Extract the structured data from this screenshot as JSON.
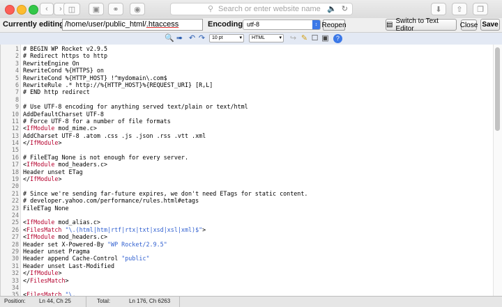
{
  "browser": {
    "address_placeholder": "Search or enter website name"
  },
  "editbar": {
    "currently_editing_label": "Currently editing:",
    "path_prefix": "/home/user/public_html/",
    "path_file": ".htaccess",
    "encoding_label": "Encoding:",
    "encoding_value": "utf-8",
    "reopen_label": "Reopen",
    "switch_label": "Switch to Text Editor",
    "close_label": "Close",
    "save_label": "Save"
  },
  "toolbar": {
    "font_size": "10 pt",
    "mode": "HTML"
  },
  "editor": {
    "lines": [
      {
        "n": "1",
        "t": "# BEGIN WP Rocket v2.9.5"
      },
      {
        "n": "2",
        "t": "# Redirect https to http"
      },
      {
        "n": "3",
        "t": "RewriteEngine On"
      },
      {
        "n": "4",
        "t": "RewriteCond %{HTTPS} on"
      },
      {
        "n": "5",
        "t": "RewriteCond %{HTTP_HOST} !^mydomain\\.com$"
      },
      {
        "n": "6",
        "t": "RewriteRule .* http://%{HTTP_HOST}%{REQUEST_URI} [R,L]"
      },
      {
        "n": "7",
        "t": "# END http redirect"
      },
      {
        "n": "8",
        "t": ""
      },
      {
        "n": "9",
        "t": "# Use UTF-8 encoding for anything served text/plain or text/html"
      },
      {
        "n": "10",
        "t": "AddDefaultCharset UTF-8"
      },
      {
        "n": "11",
        "t": "# Force UTF-8 for a number of file formats"
      },
      {
        "n": "12",
        "t": "<IfModule mod_mime.c>"
      },
      {
        "n": "13",
        "t": "AddCharset UTF-8 .atom .css .js .json .rss .vtt .xml"
      },
      {
        "n": "14",
        "t": "</IfModule>"
      },
      {
        "n": "15",
        "t": ""
      },
      {
        "n": "16",
        "t": "# FileETag None is not enough for every server."
      },
      {
        "n": "17",
        "t": "<IfModule mod_headers.c>"
      },
      {
        "n": "18",
        "t": "Header unset ETag"
      },
      {
        "n": "19",
        "t": "</IfModule>"
      },
      {
        "n": "20",
        "t": ""
      },
      {
        "n": "21",
        "t": "# Since we're sending far-future expires, we don't need ETags for static content."
      },
      {
        "n": "22",
        "t": "# developer.yahoo.com/performance/rules.html#etags"
      },
      {
        "n": "23",
        "t": "FileETag None"
      },
      {
        "n": "24",
        "t": ""
      },
      {
        "n": "25",
        "t": "<IfModule mod_alias.c>"
      },
      {
        "n": "26",
        "t": "<FilesMatch \"\\.(html|htm|rtf|rtx|txt|xsd|xsl|xml)$\">"
      },
      {
        "n": "27",
        "t": "<IfModule mod_headers.c>"
      },
      {
        "n": "28",
        "t": "Header set X-Powered-By \"WP Rocket/2.9.5\""
      },
      {
        "n": "29",
        "t": "Header unset Pragma"
      },
      {
        "n": "30",
        "t": "Header append Cache-Control \"public\""
      },
      {
        "n": "31",
        "t": "Header unset Last-Modified"
      },
      {
        "n": "32",
        "t": "</IfModule>"
      },
      {
        "n": "33",
        "t": "</FilesMatch>"
      },
      {
        "n": "34",
        "t": ""
      },
      {
        "n": "35",
        "t": "<FilesMatch \"\\."
      }
    ]
  },
  "status": {
    "position_label": "Position:",
    "position_value": "Ln 44, Ch 25",
    "total_label": "Total:",
    "total_value": "Ln 176, Ch 6263"
  },
  "colors": {
    "tag": "#b5002d",
    "string": "#2f5fd0"
  }
}
